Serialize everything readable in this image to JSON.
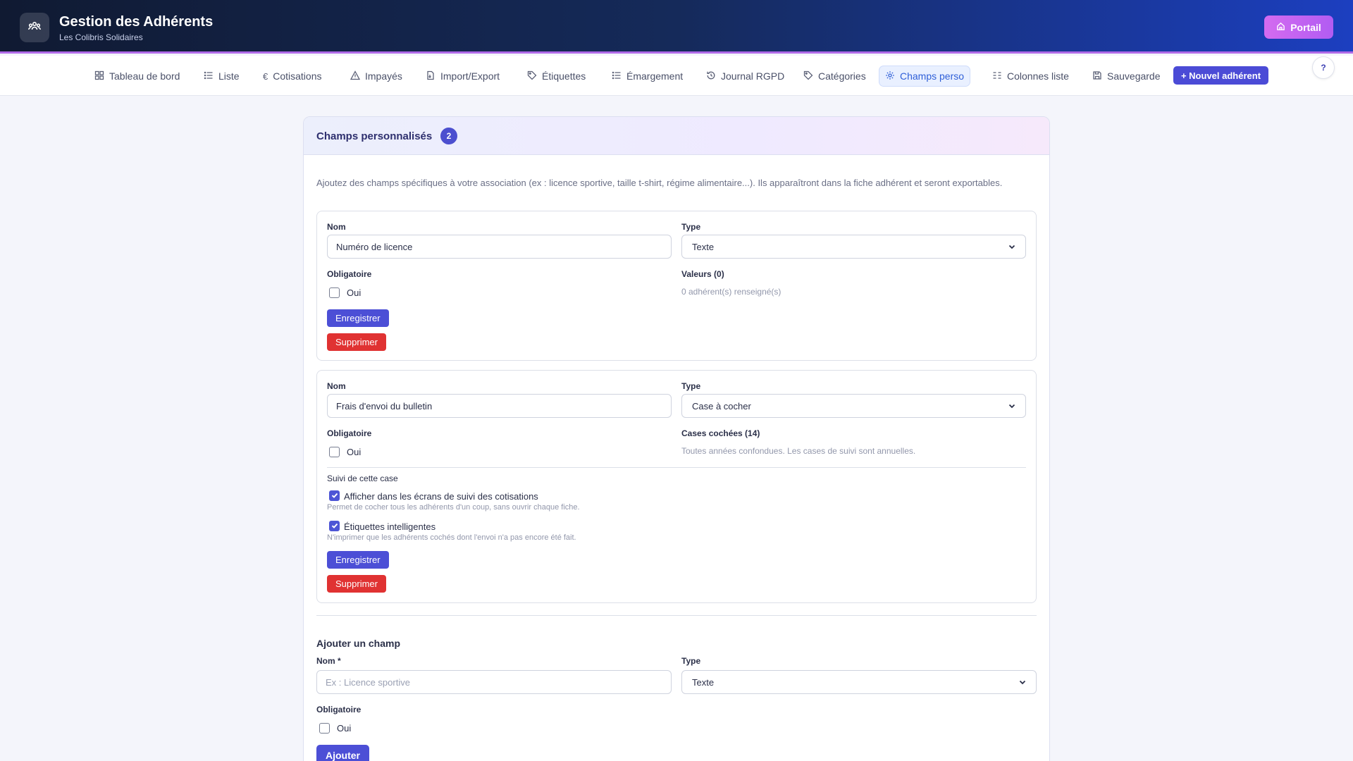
{
  "header": {
    "app_title": "Gestion des Adhérents",
    "org_name": "Les Colibris Solidaires",
    "portal_label": "Portail"
  },
  "nav": {
    "items": [
      {
        "label": "Tableau de bord",
        "icon": "dashboard-icon"
      },
      {
        "label": "Liste",
        "icon": "list-icon"
      },
      {
        "label": "Cotisations",
        "icon": "euro-icon"
      },
      {
        "label": "Impayés",
        "icon": "warning-icon"
      },
      {
        "label": "Import/Export",
        "icon": "file-transfer-icon"
      },
      {
        "label": "Étiquettes",
        "icon": "tag-icon"
      },
      {
        "label": "Émargement",
        "icon": "list-icon"
      },
      {
        "label": "Journal RGPD",
        "icon": "history-icon"
      },
      {
        "label": "Catégories",
        "icon": "tag-icon"
      },
      {
        "label": "Champs perso",
        "icon": "gear-icon",
        "active": true
      },
      {
        "label": "Colonnes liste",
        "icon": "columns-icon"
      },
      {
        "label": "Sauvegarde",
        "icon": "save-icon"
      }
    ],
    "new_member_label": "+ Nouvel adhérent",
    "help_label": "?"
  },
  "card": {
    "title": "Champs personnalisés",
    "count": "2",
    "intro": "Ajoutez des champs spécifiques à votre association (ex : licence sportive, taille t-shirt, régime alimentaire...). Ils apparaîtront dans la fiche adhérent et seront exportables."
  },
  "fields": [
    {
      "name_label": "Nom",
      "name_value": "Numéro de licence",
      "type_label": "Type",
      "type_value": "Texte",
      "required_label": "Obligatoire",
      "required_option": "Oui",
      "required_checked": false,
      "stats_title": "Valeurs (0)",
      "stats_text": "0 adhérent(s) renseigné(s)",
      "save_label": "Enregistrer",
      "delete_label": "Supprimer"
    },
    {
      "name_label": "Nom",
      "name_value": "Frais d'envoi du bulletin",
      "type_label": "Type",
      "type_value": "Case à cocher",
      "required_label": "Obligatoire",
      "required_option": "Oui",
      "required_checked": false,
      "stats_title": "Cases cochées (14)",
      "stats_text": "Toutes années confondues. Les cases de suivi sont annuelles.",
      "tracking_title": "Suivi de cette case",
      "tracking_options": [
        {
          "label": "Afficher dans les écrans de suivi des cotisations",
          "hint": "Permet de cocher tous les adhérents d'un coup, sans ouvrir chaque fiche.",
          "checked": true
        },
        {
          "label": "Étiquettes intelligentes",
          "hint": "N'imprimer que les adhérents cochés dont l'envoi n'a pas encore été fait.",
          "checked": true
        }
      ],
      "save_label": "Enregistrer",
      "delete_label": "Supprimer"
    }
  ],
  "add_field": {
    "title": "Ajouter un champ",
    "name_label": "Nom *",
    "name_placeholder": "Ex : Licence sportive",
    "type_label": "Type",
    "type_value": "Texte",
    "required_label": "Obligatoire",
    "required_option": "Oui",
    "submit_label": "Ajouter"
  },
  "colors": {
    "accent": "#4c4fd6",
    "danger": "#e03232",
    "header_start": "#101a32",
    "header_end": "#1c3fc0",
    "portal": "#c862f1"
  }
}
